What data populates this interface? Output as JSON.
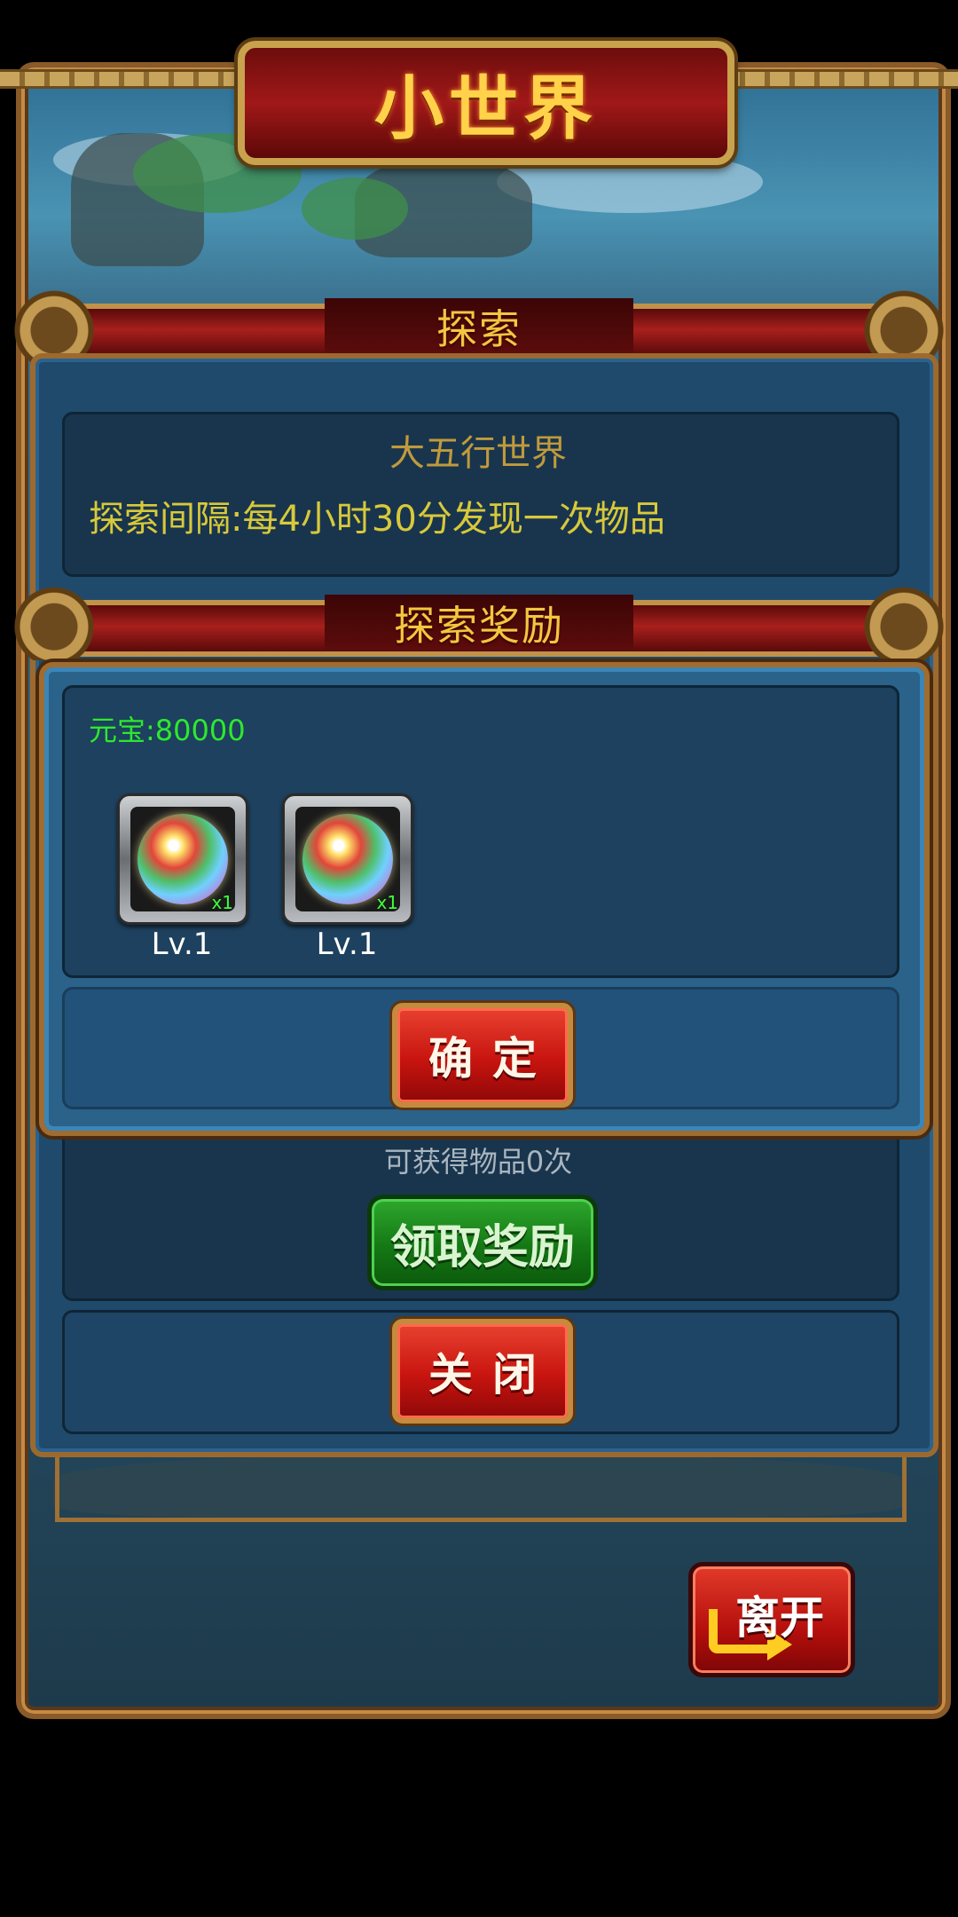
{
  "title": "小世界",
  "explore_banner": "探索",
  "explore_info": {
    "world_name": "大五行世界",
    "interval_text": "探索间隔:每4小时30分发现一次物品"
  },
  "reward_banner": "探索奖励",
  "reward_dialog": {
    "ingot_text": "元宝:80000",
    "items": [
      {
        "icon": "five-elements-orb-icon",
        "qty": "x1",
        "level": "Lv.1"
      },
      {
        "icon": "five-elements-orb-icon",
        "qty": "x1",
        "level": "Lv.1"
      }
    ],
    "confirm_label": "确定"
  },
  "claim_info": "可获得物品0次",
  "claim_button": "领取奖励",
  "close_button": "关闭",
  "leave_button": "离开",
  "colors": {
    "title_gold": "#ffd24a",
    "banner_text": "#f3c640",
    "interval_text": "#d8c93a",
    "ingot_text": "#2ee82e",
    "world_name": "#c09a3c"
  }
}
